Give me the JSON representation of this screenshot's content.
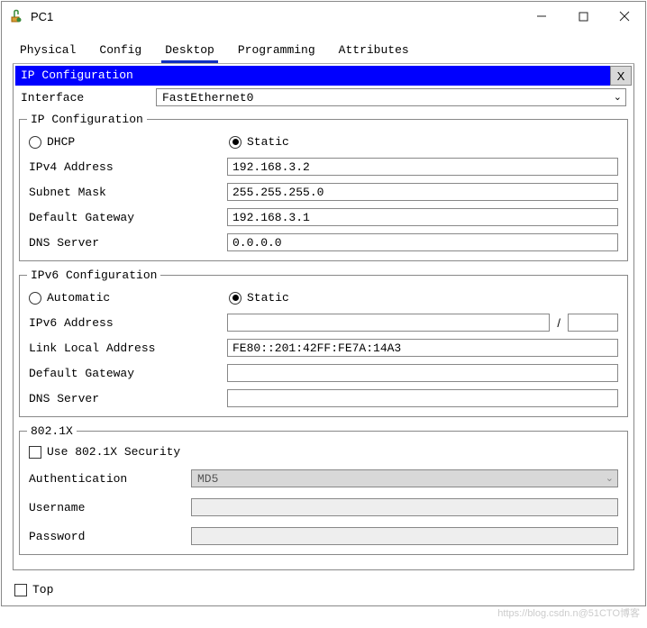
{
  "window": {
    "title": "PC1"
  },
  "tabs": {
    "physical": "Physical",
    "config": "Config",
    "desktop": "Desktop",
    "programming": "Programming",
    "attributes": "Attributes"
  },
  "panel": {
    "header": "IP Configuration",
    "close_x": "X",
    "interface_label": "Interface",
    "interface_value": "FastEthernet0"
  },
  "ipv4": {
    "legend": "IP Configuration",
    "dhcp": "DHCP",
    "static": "Static",
    "addr_label": "IPv4 Address",
    "addr_value": "192.168.3.2",
    "mask_label": "Subnet Mask",
    "mask_value": "255.255.255.0",
    "gw_label": "Default Gateway",
    "gw_value": "192.168.3.1",
    "dns_label": "DNS Server",
    "dns_value": "0.0.0.0"
  },
  "ipv6": {
    "legend": "IPv6 Configuration",
    "automatic": "Automatic",
    "static": "Static",
    "addr_label": "IPv6 Address",
    "addr_value": "",
    "prefix_value": "",
    "ll_label": "Link Local Address",
    "ll_value": "FE80::201:42FF:FE7A:14A3",
    "gw_label": "Default Gateway",
    "gw_value": "",
    "dns_label": "DNS Server",
    "dns_value": ""
  },
  "dot1x": {
    "legend": "802.1X",
    "use_label": "Use 802.1X Security",
    "auth_label": "Authentication",
    "auth_value": "MD5",
    "user_label": "Username",
    "user_value": "",
    "pass_label": "Password",
    "pass_value": ""
  },
  "bottom": {
    "top_label": "Top"
  },
  "watermark": "https://blog.csdn.n@51CTO博客"
}
